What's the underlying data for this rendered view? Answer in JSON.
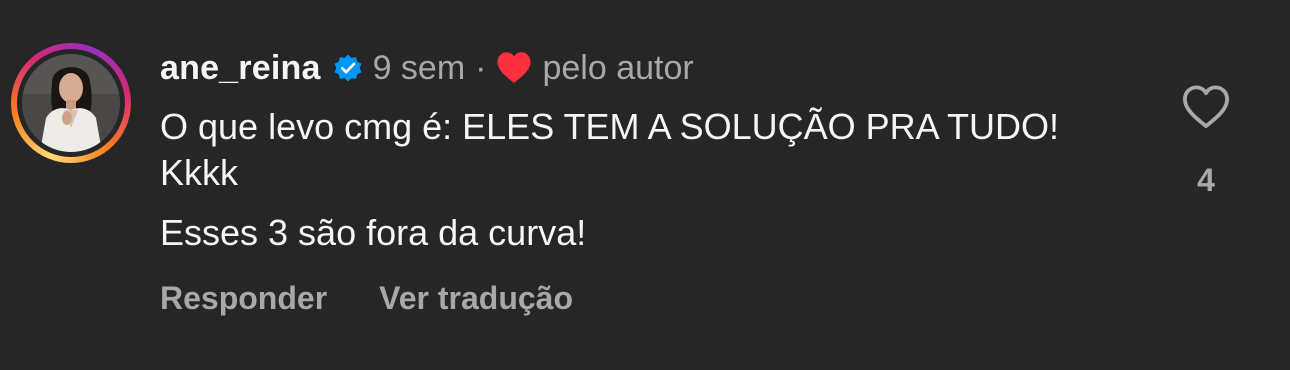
{
  "comment": {
    "username": "ane_reina",
    "time_ago": "9 sem",
    "separator": "·",
    "liked_by_author_label": "pelo autor",
    "body_line_1": "O que levo cmg é: ELES TEM A SOLUÇÃO PRA TUDO! Kkkk",
    "body_line_2": "Esses 3 são fora da curva!",
    "reply_label": "Responder",
    "translate_label": "Ver tradução",
    "like_count": "4"
  },
  "icons": {
    "verified": "verified-badge-icon",
    "author_heart": "heart-filled-icon",
    "like": "heart-outline-icon"
  },
  "colors": {
    "background": "#262626",
    "primary_text": "#f5f5f5",
    "secondary_text": "#a8a8a8",
    "verified_blue": "#0095f6",
    "heart_red": "#ff3040"
  }
}
